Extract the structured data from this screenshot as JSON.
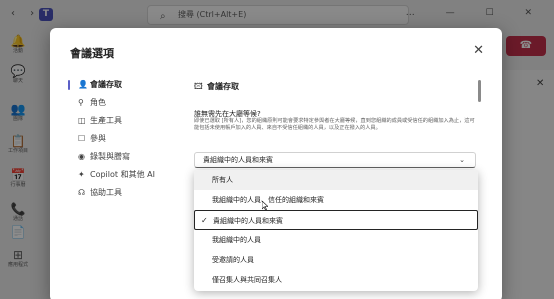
{
  "app": {
    "search_placeholder": "搜尋 (Ctrl+Alt+E)",
    "nav_arrows": "‹ ›",
    "window_controls": "… — ☐ ✕",
    "rail": [
      {
        "icon": "bell-icon",
        "glyph": "🔔",
        "label": "活動"
      },
      {
        "icon": "chat-icon",
        "glyph": "💬",
        "label": "聊天"
      },
      {
        "icon": "teams-icon",
        "glyph": "👥",
        "label": "團隊"
      },
      {
        "icon": "assignments-icon",
        "glyph": "📋",
        "label": "工作項目"
      },
      {
        "icon": "calendar-icon",
        "glyph": "📅",
        "label": "行事曆"
      },
      {
        "icon": "calls-icon",
        "glyph": "📞",
        "label": "通話"
      },
      {
        "icon": "files-icon",
        "glyph": "📄",
        "label": ""
      },
      {
        "icon": "apps-icon",
        "glyph": "⊞",
        "label": "應用程式"
      }
    ]
  },
  "dialog": {
    "title": "會議選項",
    "close_glyph": "✕",
    "nav": [
      {
        "label": "會議存取",
        "glyph": "👤",
        "active": true
      },
      {
        "label": "角色",
        "glyph": "⚲",
        "active": false
      },
      {
        "label": "生產工具",
        "glyph": "◫",
        "active": false
      },
      {
        "label": "參與",
        "glyph": "☐",
        "active": false
      },
      {
        "label": "錄製與謄寫",
        "glyph": "◉",
        "active": false
      },
      {
        "label": "Copilot 和其他 AI",
        "glyph": "✦",
        "active": false
      },
      {
        "label": "協助工具",
        "glyph": "☊",
        "active": false
      }
    ],
    "section_title": "會議存取",
    "section_glyph": "🖾",
    "question": "誰無需先在大廳等候?",
    "description": "即使已選取 [所有人]，您的組織原則可能會要求特定參與者在大廳等候，直到您組織的成員或受信任的組織加入為止，這可能包括未使用帳戶加入的人員、來自不受信任組織的人員，以及正在撥入的人員。",
    "selected_value": "貴組織中的人員和來賓",
    "chevron": "⌄"
  },
  "dropdown": {
    "check_glyph": "✓",
    "options": [
      {
        "label": "所有人",
        "selected": false,
        "hover": true
      },
      {
        "label": "我組織中的人員、信任的組織和來賓",
        "selected": false,
        "hover": false
      },
      {
        "label": "貴組織中的人員和來賓",
        "selected": true,
        "hover": false
      },
      {
        "label": "我組織中的人員",
        "selected": false,
        "hover": false
      },
      {
        "label": "受邀請的人員",
        "selected": false,
        "hover": false
      },
      {
        "label": "僅召集人與共同召集人",
        "selected": false,
        "hover": false
      }
    ]
  },
  "colors": {
    "accent": "#5b5fc7",
    "leave": "#c4314b"
  }
}
